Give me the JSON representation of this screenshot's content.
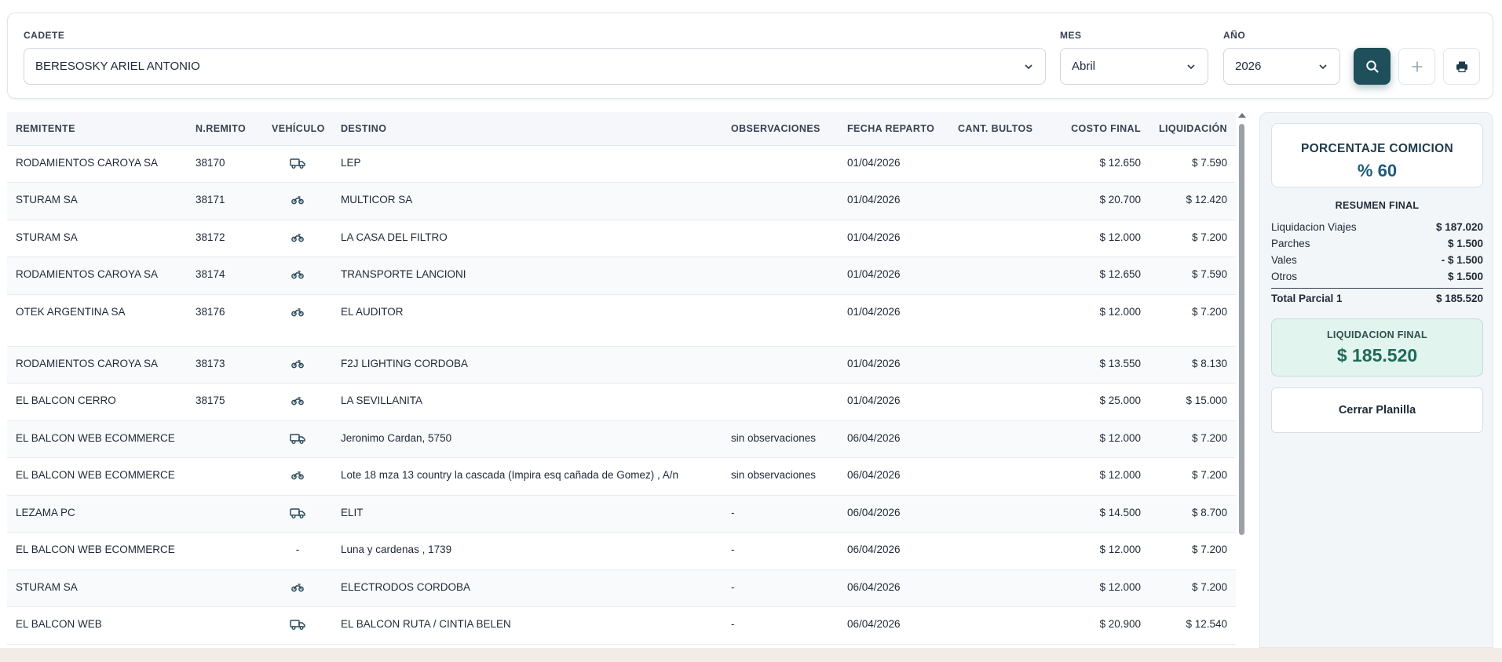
{
  "filters": {
    "cadete": {
      "label": "CADETE",
      "value": "BERESOSKY ARIEL ANTONIO"
    },
    "mes": {
      "label": "MES",
      "value": "Abril"
    },
    "anio": {
      "label": "AÑO",
      "value": "2026"
    }
  },
  "table": {
    "headers": {
      "remitente": "REMITENTE",
      "nremito": "N.REMITO",
      "vehiculo": "VEHÍCULO",
      "destino": "DESTINO",
      "observaciones": "OBSERVACIONES",
      "fecha": "FECHA REPARTO",
      "bultos": "CANT. BULTOS",
      "costo": "COSTO FINAL",
      "liquidacion": "LIQUIDACIÓN"
    },
    "rows": [
      {
        "remitente": "RODAMIENTOS CAROYA SA",
        "nremito": "38170",
        "vehiculo": "truck",
        "destino": "LEP",
        "observaciones": "",
        "fecha": "01/04/2026",
        "bultos": "",
        "costo": "$ 12.650",
        "liquidacion": "$ 7.590"
      },
      {
        "remitente": "STURAM SA",
        "nremito": "38171",
        "vehiculo": "moto",
        "destino": "MULTICOR SA",
        "observaciones": "",
        "fecha": "01/04/2026",
        "bultos": "",
        "costo": "$ 20.700",
        "liquidacion": "$ 12.420"
      },
      {
        "remitente": "STURAM SA",
        "nremito": "38172",
        "vehiculo": "moto",
        "destino": "LA CASA DEL FILTRO",
        "observaciones": "",
        "fecha": "01/04/2026",
        "bultos": "",
        "costo": "$ 12.000",
        "liquidacion": "$ 7.200"
      },
      {
        "remitente": "RODAMIENTOS CAROYA SA",
        "nremito": "38174",
        "vehiculo": "moto",
        "destino": "TRANSPORTE LANCIONI",
        "observaciones": "",
        "fecha": "01/04/2026",
        "bultos": "",
        "costo": "$ 12.650",
        "liquidacion": "$ 7.590"
      },
      {
        "remitente": "OTEK ARGENTINA SA",
        "nremito": "38176",
        "vehiculo": "moto",
        "destino": "EL AUDITOR",
        "observaciones": "",
        "fecha": "01/04/2026",
        "bultos": "",
        "costo": "$ 12.000",
        "liquidacion": "$ 7.200"
      },
      {
        "remitente": "RODAMIENTOS CAROYA SA",
        "nremito": "38173",
        "vehiculo": "moto",
        "destino": "F2J LIGHTING CORDOBA",
        "observaciones": "",
        "fecha": "01/04/2026",
        "bultos": "",
        "costo": "$ 13.550",
        "liquidacion": "$ 8.130"
      },
      {
        "remitente": "EL BALCON CERRO",
        "nremito": "38175",
        "vehiculo": "moto",
        "destino": "LA SEVILLANITA",
        "observaciones": "",
        "fecha": "01/04/2026",
        "bultos": "",
        "costo": "$ 25.000",
        "liquidacion": "$ 15.000"
      },
      {
        "remitente": "EL BALCON WEB ECOMMERCE",
        "nremito": "",
        "vehiculo": "truck",
        "destino": "Jeronimo Cardan, 5750",
        "observaciones": "sin observaciones",
        "fecha": "06/04/2026",
        "bultos": "",
        "costo": "$ 12.000",
        "liquidacion": "$ 7.200"
      },
      {
        "remitente": "EL BALCON WEB ECOMMERCE",
        "nremito": "",
        "vehiculo": "moto",
        "destino": "Lote 18 mza 13 country la cascada (Impira esq cañada de Gomez) , A/n",
        "observaciones": "sin observaciones",
        "fecha": "06/04/2026",
        "bultos": "",
        "costo": "$ 12.000",
        "liquidacion": "$ 7.200"
      },
      {
        "remitente": "LEZAMA PC",
        "nremito": "",
        "vehiculo": "truck",
        "destino": "ELIT",
        "observaciones": "-",
        "fecha": "06/04/2026",
        "bultos": "",
        "costo": "$ 14.500",
        "liquidacion": "$ 8.700"
      },
      {
        "remitente": "EL BALCON WEB ECOMMERCE",
        "nremito": "",
        "vehiculo": "-",
        "destino": "Luna y cardenas , 1739",
        "observaciones": "-",
        "fecha": "06/04/2026",
        "bultos": "",
        "costo": "$ 12.000",
        "liquidacion": "$ 7.200"
      },
      {
        "remitente": "STURAM SA",
        "nremito": "",
        "vehiculo": "moto",
        "destino": "ELECTRODOS CORDOBA",
        "observaciones": "-",
        "fecha": "06/04/2026",
        "bultos": "",
        "costo": "$ 12.000",
        "liquidacion": "$ 7.200"
      },
      {
        "remitente": "EL BALCON WEB",
        "nremito": "",
        "vehiculo": "truck",
        "destino": "EL BALCON RUTA / CINTIA BELEN",
        "observaciones": "-",
        "fecha": "06/04/2026",
        "bultos": "",
        "costo": "$ 20.900",
        "liquidacion": "$ 12.540"
      }
    ]
  },
  "panel": {
    "porcentaje_title": "PORCENTAJE COMICION",
    "porcentaje_value": "% 60",
    "resumen_title": "RESUMEN FINAL",
    "resumen": [
      {
        "label": "Liquidacion Viajes",
        "value": "$ 187.020"
      },
      {
        "label": "Parches",
        "value": "$ 1.500"
      },
      {
        "label": "Vales",
        "value": "- $ 1.500"
      },
      {
        "label": "Otros",
        "value": "$ 1.500"
      }
    ],
    "total_label": "Total Parcial 1",
    "total_value": "$ 185.520",
    "final_title": "LIQUIDACION FINAL",
    "final_value": "$ 185.520",
    "close_label": "Cerrar Planilla"
  },
  "colors": {
    "primary": "#1e4f5b",
    "final_bg": "#e2f4ee",
    "final_text": "#1d6b57",
    "percent_text": "#1e5a7a"
  }
}
